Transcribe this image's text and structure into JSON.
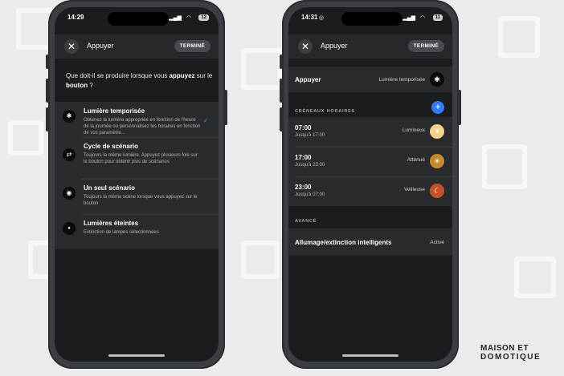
{
  "left_phone": {
    "status": {
      "time": "14:29",
      "battery": "12"
    },
    "navbar": {
      "title": "Appuyer",
      "done_label": "TERMINÉ"
    },
    "question": {
      "prefix": "Que doit-il se produire lorsque vous ",
      "bold1": "appuyez",
      "mid": " sur le ",
      "bold2": "bouton",
      "suffix": " ?"
    },
    "options": [
      {
        "icon": "timed-light-icon",
        "glyph": "✱",
        "title": "Lumière temporisée",
        "desc": "Obtenez la lumière appropriée en fonction de l'heure de la journée ou personnalisez les horaires en fonction de vos paramètre...",
        "selected": true
      },
      {
        "icon": "cycle-icon",
        "glyph": "⇄",
        "title": "Cycle de scénario",
        "desc": "Toujours la même lumière. Appuyez plusieurs fois sur le bouton pour obtenir plus de scénarios",
        "selected": false
      },
      {
        "icon": "scene-icon",
        "glyph": "◉",
        "title": "Un seul scénario",
        "desc": "Toujours la même scène lorsque vous appuyez sur le bouton",
        "selected": false
      },
      {
        "icon": "lights-off-icon",
        "glyph": "●",
        "title": "Lumières éteintes",
        "desc": "Extinction de lampes sélectionnées",
        "selected": false
      }
    ]
  },
  "right_phone": {
    "status": {
      "time": "14:31",
      "battery": "11"
    },
    "navbar": {
      "title": "Appuyer",
      "done_label": "TERMINÉ"
    },
    "press_row": {
      "title": "Appuyer",
      "value": "Lumière temporisée"
    },
    "slots_header": "CRÉNEAUX HORAIRES",
    "slots": [
      {
        "time": "07:00",
        "until": "Jusqu'à 17:00",
        "mode": "Lumineux",
        "color": "#f2d38a",
        "glyph": "☀"
      },
      {
        "time": "17:00",
        "until": "Jusqu'à 23:00",
        "mode": "Atténué",
        "color": "#c48a2e",
        "glyph": "☀"
      },
      {
        "time": "23:00",
        "until": "Jusqu'à 07:00",
        "mode": "Veilleuse",
        "color": "#c2512a",
        "glyph": "☾"
      }
    ],
    "advanced_header": "AVANCÉ",
    "smart_row": {
      "title": "Allumage/extinction intelligents",
      "value": "Activé"
    }
  },
  "logo": {
    "line1": "MAISON ET",
    "line2": "DOMOTIQUE"
  },
  "colors": {
    "accent_blue": "#2f7cf6",
    "check_blue": "#3b82f6"
  }
}
